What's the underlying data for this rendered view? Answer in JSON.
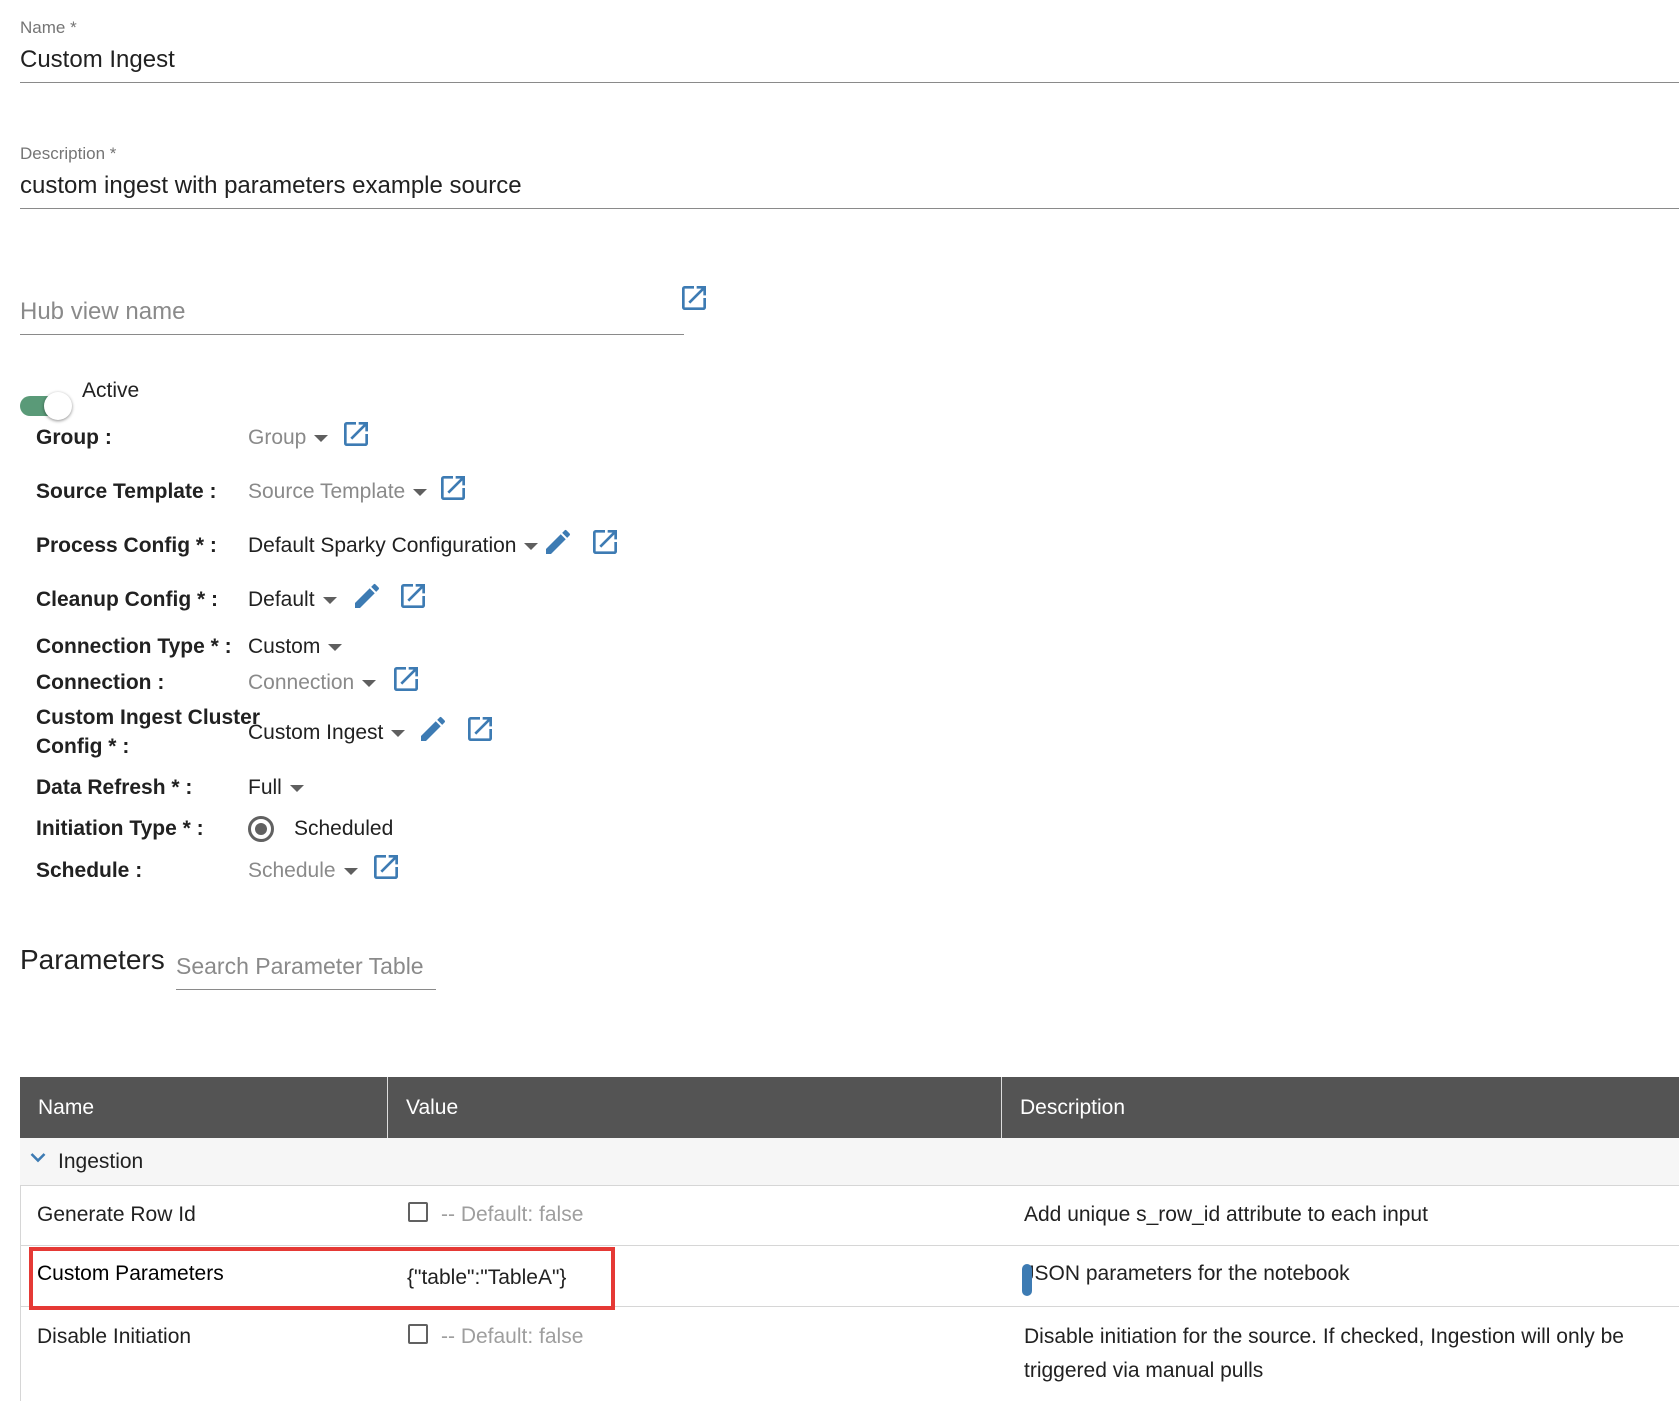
{
  "name_field": {
    "label": "Name *",
    "value": "Custom Ingest"
  },
  "description_field": {
    "label": "Description *",
    "value": "custom ingest with parameters example source"
  },
  "hub_view": {
    "placeholder": "Hub view name"
  },
  "active_toggle": {
    "label": "Active",
    "on": true,
    "color": "#5a9a78"
  },
  "form_rows": {
    "group": {
      "label": "Group :",
      "value": "Group",
      "muted": true
    },
    "source_template": {
      "label": "Source Template :",
      "value": "Source Template",
      "muted": true
    },
    "process_config": {
      "label": "Process Config * :",
      "value": "Default Sparky Configuration"
    },
    "cleanup_config": {
      "label": "Cleanup Config * :",
      "value": "Default"
    },
    "connection_type": {
      "label": "Connection Type * :",
      "value": "Custom"
    },
    "connection": {
      "label": "Connection :",
      "value": "Connection",
      "muted": true
    },
    "custom_ingest_cluster": {
      "label_line1": "Custom Ingest Cluster",
      "label_line2": "Config * :",
      "value": "Custom Ingest"
    },
    "data_refresh": {
      "label": "Data Refresh * :",
      "value": "Full"
    },
    "initiation_type": {
      "label": "Initiation Type * :",
      "value": "Scheduled",
      "selected": true
    },
    "schedule": {
      "label": "Schedule :",
      "value": "Schedule",
      "muted": true
    }
  },
  "parameters": {
    "title": "Parameters",
    "search_placeholder": "Search Parameter Table",
    "columns": [
      "Name",
      "Value",
      "Description"
    ],
    "group": {
      "label": "Ingestion",
      "expanded": true
    },
    "rows": [
      {
        "name": "Generate Row Id",
        "value": "-- Default: false",
        "value_type": "checkbox",
        "description": "Add unique s_row_id attribute to each input"
      },
      {
        "name": "Custom Parameters",
        "value": "{\"table\":\"TableA\"}",
        "value_type": "text",
        "description": "JSON parameters for the notebook",
        "highlighted": true
      },
      {
        "name": "Disable Initiation",
        "value": "-- Default: false",
        "value_type": "checkbox",
        "description_line1": "Disable initiation for the source. If checked, Ingestion will only be",
        "description_line2": "triggered via manual pulls"
      }
    ]
  },
  "colors": {
    "icon_blue": "#3d7bb3",
    "header_bg": "#545454",
    "highlight_red": "#e53935"
  }
}
